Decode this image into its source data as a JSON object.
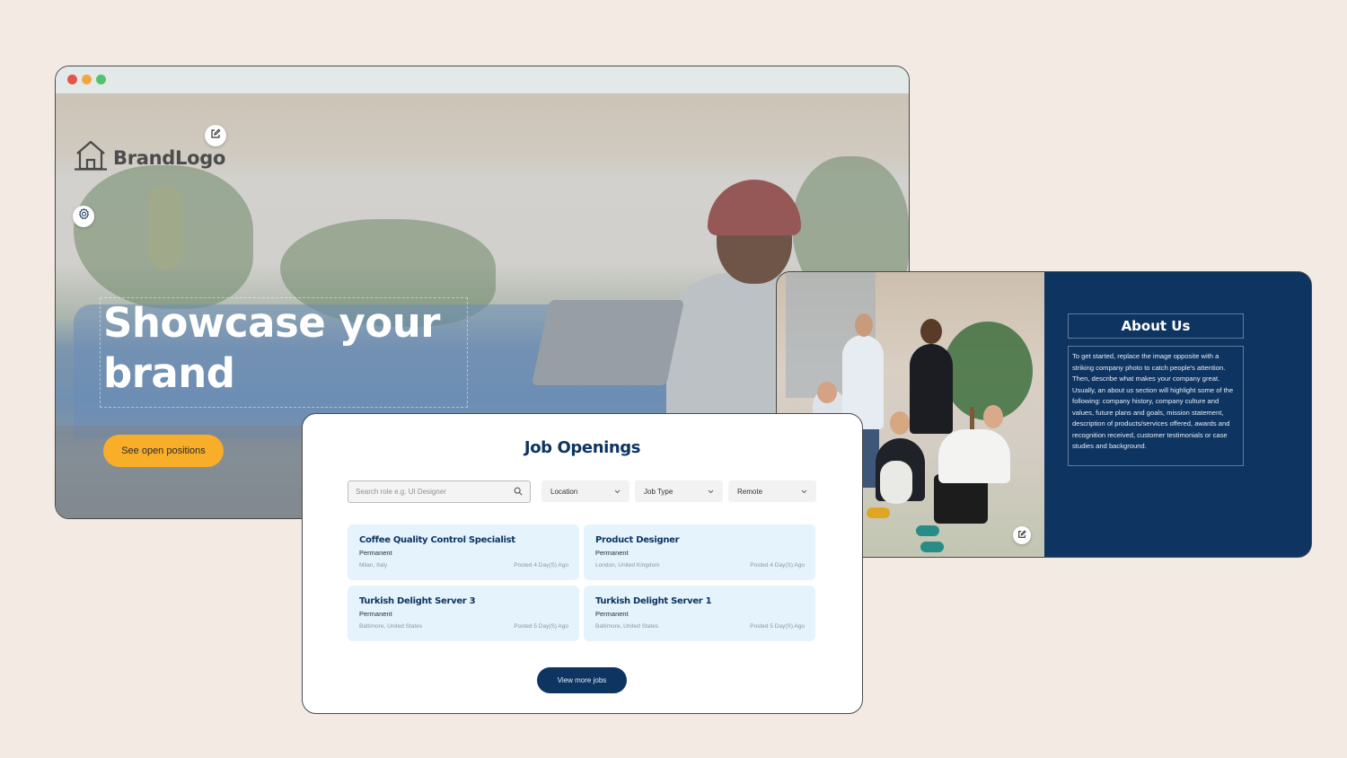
{
  "colors": {
    "background": "#f3ebe3",
    "navy": "#0e3561",
    "accent_orange": "#f8ae29",
    "card_blue": "#e5f3fd",
    "traffic_red": "#e5534b",
    "traffic_yellow": "#f0a742",
    "traffic_green": "#55c16e"
  },
  "hero": {
    "window_controls": [
      "close",
      "minimize",
      "maximize"
    ],
    "brand": {
      "icon": "house-icon",
      "name": "BrandLogo"
    },
    "edit_icon": "edit-icon",
    "settings_icon": "gear-icon",
    "title": "Showcase your brand",
    "cta_label": "See open positions"
  },
  "about": {
    "photo_edit_icon": "edit-icon",
    "title": "About Us",
    "body": "To get started, replace the image opposite with a striking company photo to catch people's attention. Then, describe what makes your company great. Usually, an about us section will highlight some of the following: company history, company culture and values, future plans and goals, mission statement, description of products/services offered, awards and recognition received, customer testimonials or case studies and background."
  },
  "jobs": {
    "title": "Job Openings",
    "search": {
      "placeholder": "Search role e.g. UI Designer",
      "value": "",
      "icon": "search-icon"
    },
    "filters": [
      {
        "label": "Location",
        "icon": "chevron-down-icon"
      },
      {
        "label": "Job Type",
        "icon": "chevron-down-icon"
      },
      {
        "label": "Remote",
        "icon": "chevron-down-icon"
      }
    ],
    "listings": [
      {
        "title": "Coffee Quality Control Specialist",
        "type": "Permanent",
        "location": "Milan, Italy",
        "posted": "Posted 4 Day(S) Ago"
      },
      {
        "title": "Product Designer",
        "type": "Permanent",
        "location": "London, United Kingdom",
        "posted": "Posted 4 Day(S) Ago"
      },
      {
        "title": "Turkish Delight Server 3",
        "type": "Permanent",
        "location": "Baltimore, United States",
        "posted": "Posted 5 Day(S) Ago"
      },
      {
        "title": "Turkish Delight Server 1",
        "type": "Permanent",
        "location": "Baltimore, United States",
        "posted": "Posted 5 Day(S) Ago"
      }
    ],
    "more_label": "View more jobs"
  }
}
